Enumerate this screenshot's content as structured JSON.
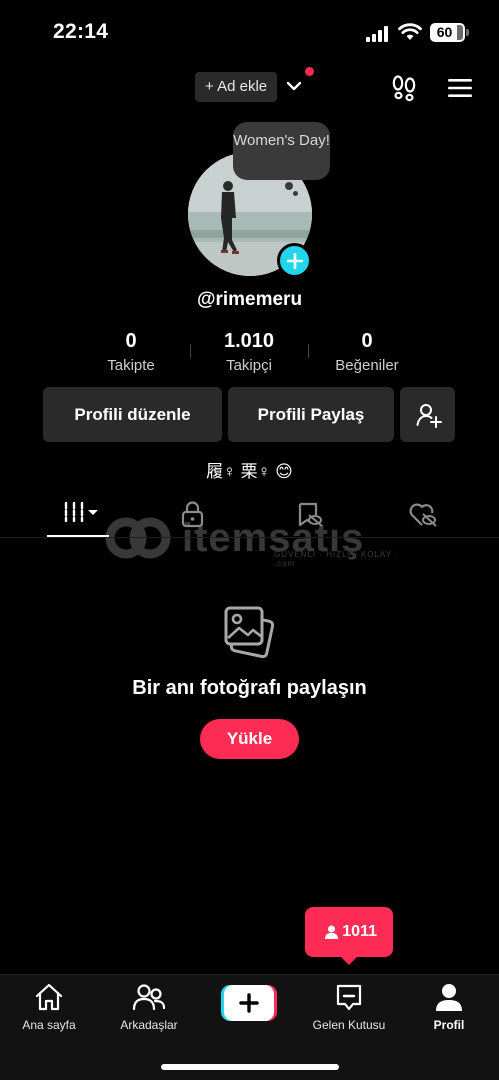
{
  "status_bar": {
    "time": "22:14",
    "battery": "60"
  },
  "top_bar": {
    "add_label": "+ Ad ekle",
    "icons": [
      "chevron-down-icon",
      "footprints-icon",
      "menu-icon"
    ]
  },
  "profile": {
    "note": "Women's Day!",
    "username": "@rimemeru",
    "bio": "履♀ 栗♀ 😊"
  },
  "stats": [
    {
      "value": "0",
      "label": "Takipte"
    },
    {
      "value": "1.010",
      "label": "Takipçi"
    },
    {
      "value": "0",
      "label": "Beğeniler"
    }
  ],
  "actions": {
    "edit_profile": "Profili düzenle",
    "share_profile": "Profili Paylaş"
  },
  "watermark": {
    "brand": "itemsatış",
    "tagline": "GÜVENLİ · HIZLI · KOLAY · .com"
  },
  "empty_state": {
    "title": "Bir anı fotoğrafı paylaşın",
    "upload": "Yükle"
  },
  "toast": {
    "count": "1011"
  },
  "bottom_nav": {
    "home": "Ana sayfa",
    "friends": "Arkadaşlar",
    "inbox": "Gelen Kutusu",
    "profile": "Profil"
  },
  "colors": {
    "accent": "#fe2c55",
    "cyan": "#20d5ec",
    "background": "#000000"
  }
}
